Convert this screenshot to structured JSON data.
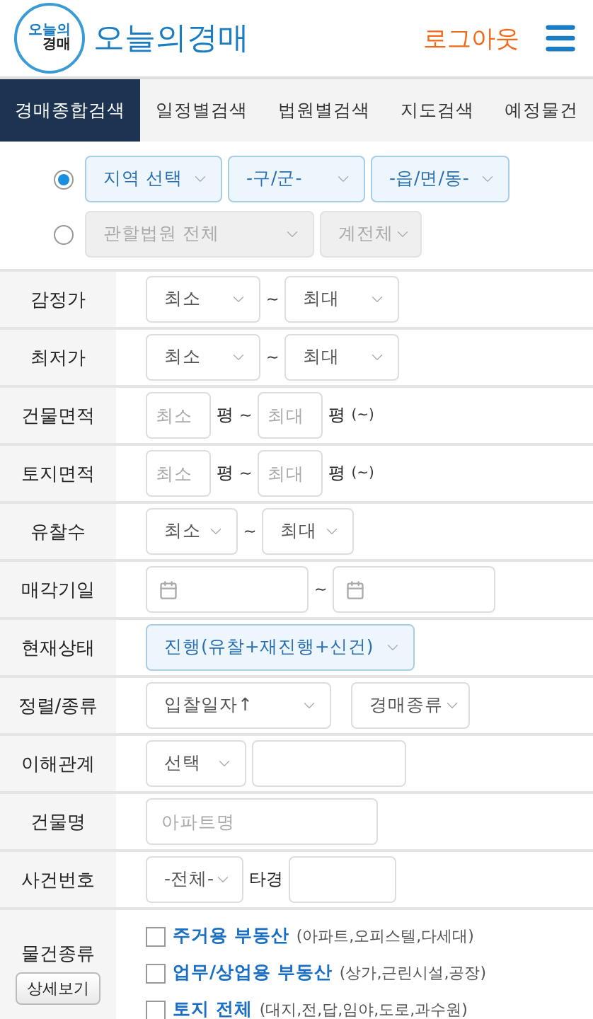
{
  "header": {
    "logo": {
      "top": "오늘의",
      "bottom": "경매"
    },
    "brand": "오늘의경매",
    "logout": "로그아웃"
  },
  "tabs": [
    {
      "label": "경매종합검색",
      "selected": true
    },
    {
      "label": "일정별검색",
      "selected": false
    },
    {
      "label": "법원별검색",
      "selected": false
    },
    {
      "label": "지도검색",
      "selected": false
    },
    {
      "label": "예정물건",
      "selected": false
    }
  ],
  "region_options": [
    {
      "selected": true,
      "disabled": false,
      "selects": [
        "지역 선택",
        "-구/군-",
        "-읍/면/동-"
      ]
    },
    {
      "selected": false,
      "disabled": true,
      "selects": [
        "관할법원 전체",
        "계전체"
      ]
    }
  ],
  "rows": [
    {
      "label": "감정가",
      "kind": "range-select",
      "min": "최소",
      "max": "최대",
      "separator": "~"
    },
    {
      "label": "최저가",
      "kind": "range-select",
      "min": "최소",
      "max": "최대",
      "separator": "~"
    },
    {
      "label": "건물면적",
      "kind": "area",
      "min_placeholder": "최소",
      "max_placeholder": "최대",
      "min_unit": "평",
      "max_unit": "평",
      "separator": "~",
      "note": "(~)"
    },
    {
      "label": "토지면적",
      "kind": "area",
      "min_placeholder": "최소",
      "max_placeholder": "최대",
      "min_unit": "평",
      "max_unit": "평",
      "separator": "~",
      "note": "(~)"
    },
    {
      "label": "유찰수",
      "kind": "small-range-select",
      "min": "최소",
      "max": "최대",
      "separator": "~"
    },
    {
      "label": "매각기일",
      "kind": "date-range",
      "separator": "~"
    },
    {
      "label": "현재상태",
      "kind": "status-select",
      "value": "진행(유찰+재진행+신건)"
    },
    {
      "label": "정렬/종류",
      "kind": "two-selects",
      "values": [
        "입찰일자↑",
        "경매종류"
      ]
    },
    {
      "label": "이해관계",
      "kind": "select-input",
      "value": "선택"
    },
    {
      "label": "건물명",
      "kind": "text-input",
      "placeholder": "아파트명"
    },
    {
      "label": "사건번호",
      "kind": "case-number",
      "value": "-전체-",
      "text": "타경"
    },
    {
      "label": "물건종류",
      "kind": "categories",
      "button": "상세보기",
      "items": [
        {
          "name": "주거용 부동산",
          "detail": "(아파트,오피스텔,다세대)",
          "checked": false
        },
        {
          "name": "업무/상업용 부동산",
          "detail": "(상가,근린시설,공장)",
          "checked": false
        },
        {
          "name": "토지 전체",
          "detail": "(대지,전,답,임야,도로,과수원)",
          "checked": false
        }
      ]
    }
  ]
}
